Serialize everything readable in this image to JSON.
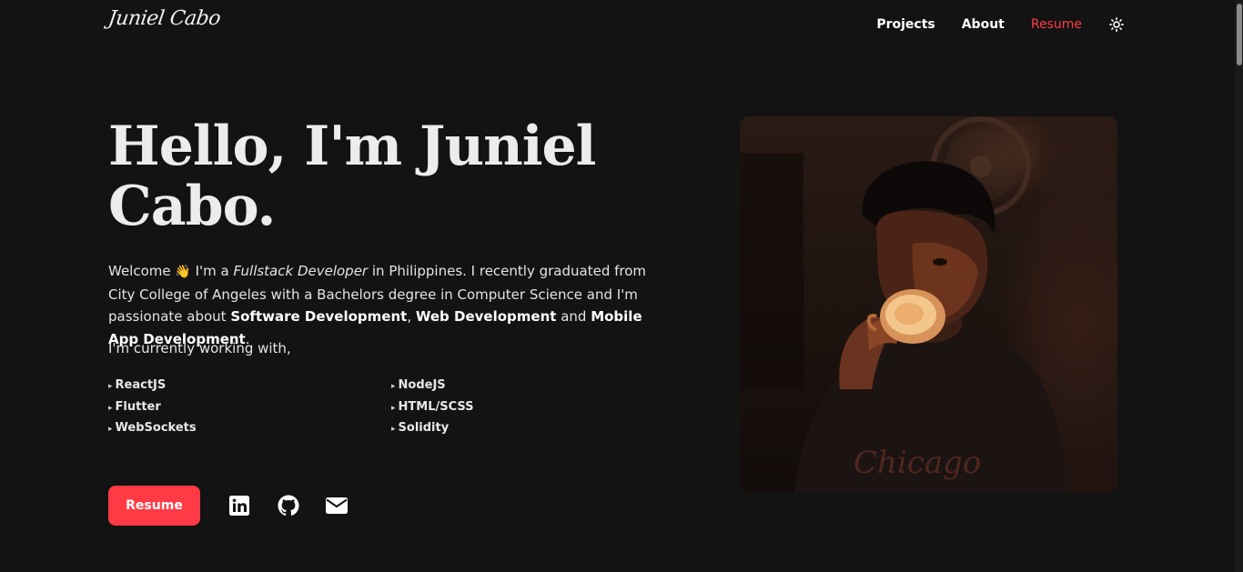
{
  "header": {
    "logo_text": "Juniel Cabo",
    "nav": [
      {
        "label": "Projects"
      },
      {
        "label": "About"
      },
      {
        "label": "Resume"
      }
    ],
    "theme_icon": "sun-icon"
  },
  "hero": {
    "title": "Hello, I'm Juniel Cabo.",
    "intro": {
      "welcome": "Welcome",
      "wave_emoji": "👋",
      "text1": " I'm a ",
      "role": "Fullstack Developer",
      "text2": " in Philippines. I recently graduated from City College of Angeles with a Bachelors degree in Computer Science and I'm passionate about ",
      "skill1": "Software Development",
      "sep1": ", ",
      "skill2": "Web Development",
      "sep2": " and ",
      "skill3": "Mobile App Development",
      "end": "."
    },
    "working_with": "I'm currently working with,",
    "tech_col1": [
      "ReactJS",
      "Flutter",
      "WebSockets"
    ],
    "tech_col2": [
      "NodeJS",
      "HTML/SCSS",
      "Solidity"
    ]
  },
  "actions": {
    "resume_label": "Resume",
    "icons": [
      "linkedin-icon",
      "github-icon",
      "mail-icon"
    ]
  },
  "colors": {
    "background": "#131313",
    "accent": "#ff3a44",
    "text": "#ececec"
  }
}
